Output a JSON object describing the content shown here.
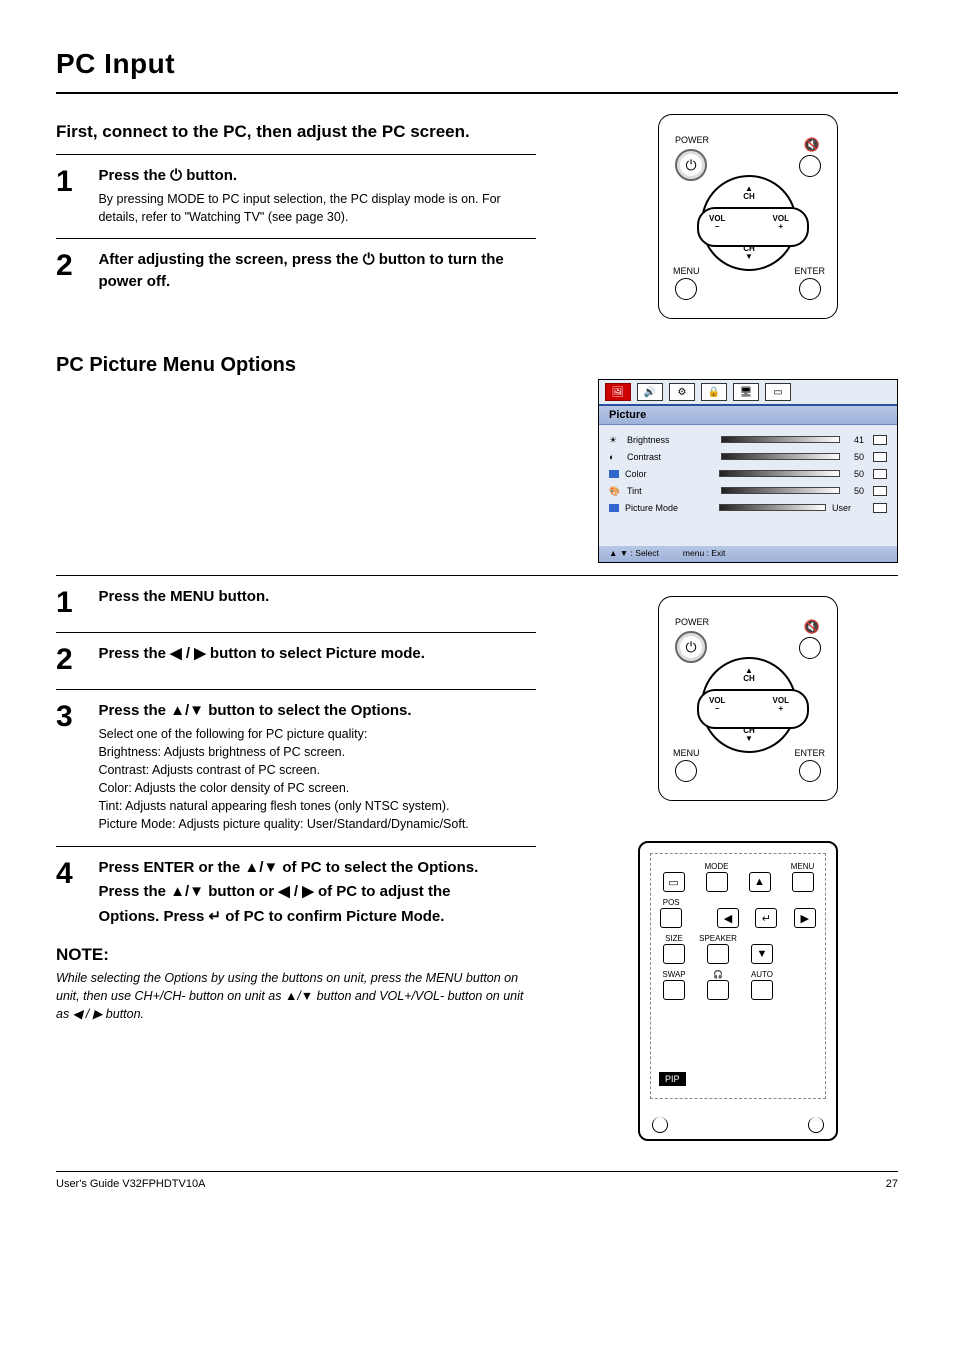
{
  "header": {
    "title": "PC Input"
  },
  "sectionA": {
    "lead": "First, connect to the PC, then adjust the PC screen.",
    "steps": [
      {
        "num": "1",
        "title_prefix": "Press the ",
        "title_suffix": " button.",
        "body": "By pressing MODE to PC input selection, the PC display mode is on. For details, refer to \"Watching TV\" (see page 30)."
      },
      {
        "num": "2",
        "title_prefix": "After adjusting the screen, press the ",
        "title_suffix": " button to turn the power off."
      }
    ]
  },
  "remote": {
    "power": "POWER",
    "menu": "MENU",
    "enter": "ENTER",
    "vol_minus": "VOL\n–",
    "vol_plus": "VOL\n+",
    "ch_up": "▲\nCH",
    "ch_down": "CH\n▼"
  },
  "pcmenu": {
    "title": "PC Picture Menu Options",
    "steps": [
      {
        "num": "1",
        "title": "Press the MENU button."
      },
      {
        "num": "2",
        "title_prefix": "Press the ",
        "title_glyph": "◀ / ▶",
        "title_suffix": " button to select Picture mode."
      },
      {
        "num": "3",
        "title_prefix": "Press the ",
        "title_glyph": "▲/▼",
        "title_suffix": " button to select the Options.",
        "list_lead": "Select one of the following for PC picture quality:",
        "options": [
          "Brightness: Adjusts brightness of PC screen.",
          "Contrast: Adjusts contrast of PC screen.",
          "Color: Adjusts the color density of PC screen.",
          "Tint: Adjusts natural appearing flesh tones (only NTSC system).",
          "Picture Mode: Adjusts picture quality: User/Standard/Dynamic/Soft."
        ]
      },
      {
        "num": "4",
        "lines": [
          {
            "prefix": "Press ENTER or the ",
            "g": "▲/▼",
            "suffix": " of PC to select the Options."
          },
          {
            "prefix": "Press the ",
            "g": "▲/▼",
            "suffix": " button or ",
            "g2": "◀ / ▶",
            "suffix2": " of PC to adjust the"
          },
          {
            "prefix": "Options. Press ",
            "g": "↵",
            "suffix": " of PC to confirm Picture Mode."
          }
        ]
      }
    ],
    "note_label": "NOTE:",
    "note_text": "While selecting the Options by using the buttons on unit, press the MENU button on unit, then use CH+/CH- button on unit as ▲/▼ button and VOL+/VOL- button on unit as ◀ / ▶ button."
  },
  "osd": {
    "title": "Picture",
    "rows": [
      {
        "label": "Brightness",
        "val": "41"
      },
      {
        "label": "Contrast",
        "val": "50"
      },
      {
        "label": "Color",
        "val": "50"
      },
      {
        "label": "Tint",
        "val": "50"
      },
      {
        "label": "Picture Mode",
        "val": "",
        "inline_val": "User"
      }
    ],
    "foot": [
      "▲ ▼ :  Select",
      "menu :  Exit"
    ]
  },
  "remote2": {
    "labels": {
      "mode": "MODE",
      "menu": "MENU",
      "pos": "POS",
      "size": "SIZE",
      "speaker": "SPEAKER",
      "swap": "SWAP",
      "auto": "AUTO",
      "pip": "PIP"
    },
    "hp_icon": "🎧"
  },
  "footer": {
    "left": "User's Guide V32FPHDTV10A",
    "right": "27"
  }
}
